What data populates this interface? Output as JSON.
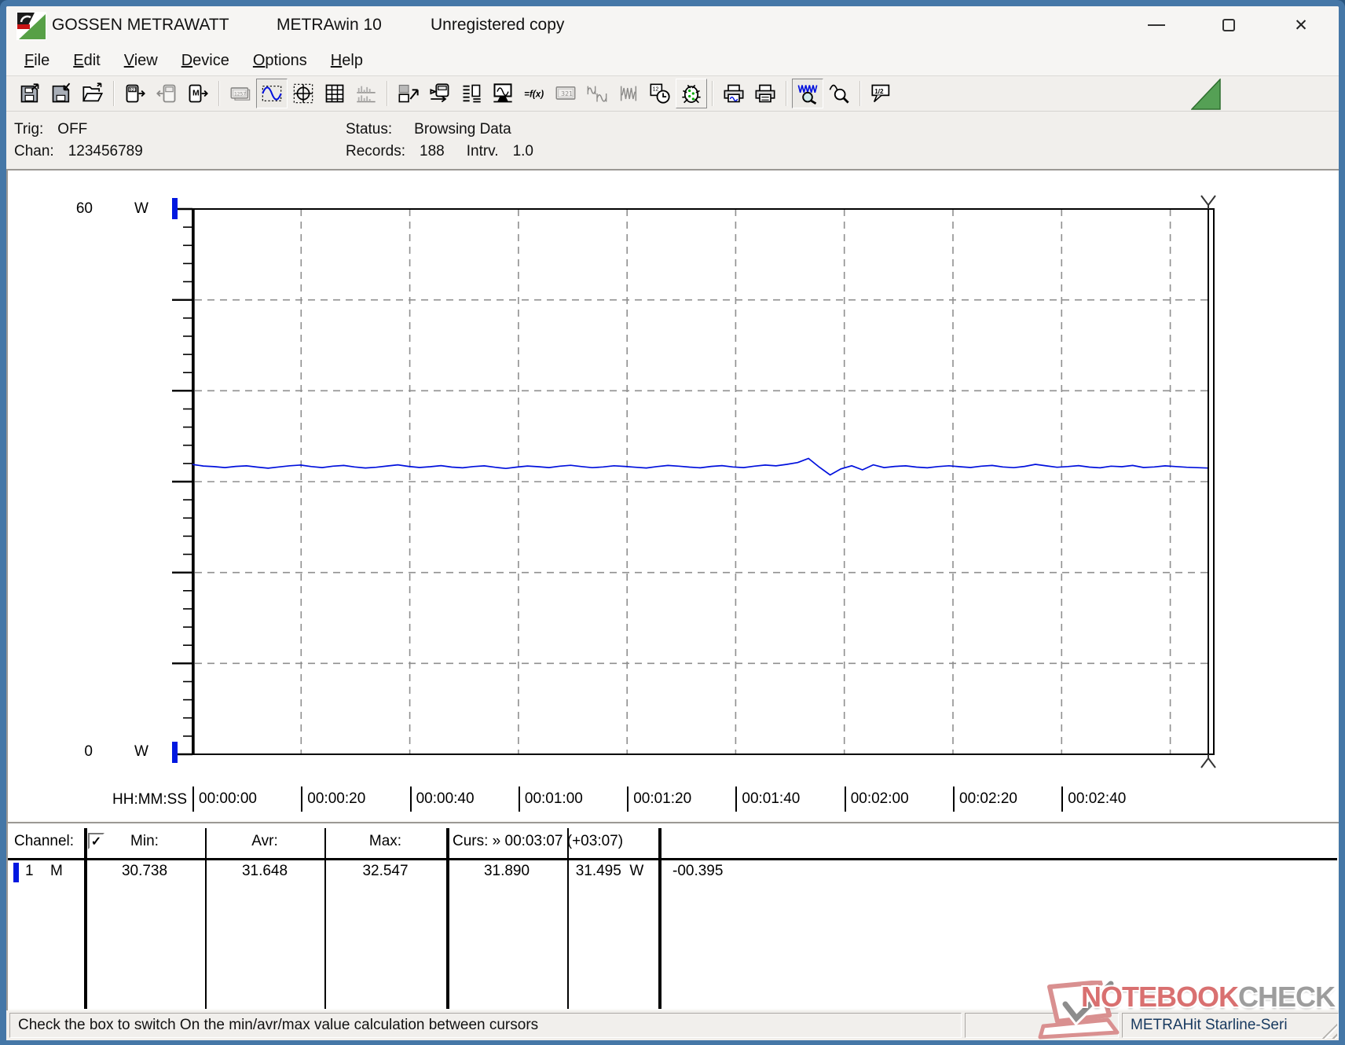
{
  "titlebar": {
    "brand": "GOSSEN METRAWATT",
    "app": "METRAwin 10",
    "license": "Unregistered copy",
    "close_glyph": "✕",
    "icons": [
      "brand-logo",
      "minimize-icon",
      "maximize-icon",
      "close-icon"
    ]
  },
  "menu": {
    "items": [
      {
        "label": "File",
        "accel": 0
      },
      {
        "label": "Edit",
        "accel": 0
      },
      {
        "label": "View",
        "accel": 0
      },
      {
        "label": "Device",
        "accel": 0
      },
      {
        "label": "Options",
        "accel": 0
      },
      {
        "label": "Help",
        "accel": 0
      }
    ]
  },
  "toolbar": {
    "groups": [
      {
        "buttons": [
          {
            "name": "save-as",
            "state": "normal"
          },
          {
            "name": "save",
            "state": "normal"
          },
          {
            "name": "open",
            "state": "normal"
          }
        ]
      },
      {
        "buttons": [
          {
            "name": "read-device",
            "state": "normal"
          },
          {
            "name": "send-device",
            "state": "disabled"
          },
          {
            "name": "read-memory",
            "state": "normal"
          }
        ]
      },
      {
        "buttons": [
          {
            "name": "numeric-display",
            "state": "disabled"
          },
          {
            "name": "chart-view",
            "state": "pressed"
          },
          {
            "name": "xy-view",
            "state": "normal"
          },
          {
            "name": "table-view",
            "state": "normal"
          },
          {
            "name": "histogram-view",
            "state": "disabled"
          }
        ]
      },
      {
        "buttons": [
          {
            "name": "export-transfer",
            "state": "normal"
          },
          {
            "name": "device-settings",
            "state": "normal"
          },
          {
            "name": "channel-list",
            "state": "normal"
          },
          {
            "name": "monitor-view",
            "state": "normal"
          },
          {
            "name": "formula",
            "state": "normal"
          },
          {
            "name": "display-321",
            "state": "disabled"
          },
          {
            "name": "compare-curves",
            "state": "disabled"
          },
          {
            "name": "envelope",
            "state": "disabled"
          },
          {
            "name": "time-clock",
            "state": "normal"
          },
          {
            "name": "debug-bug",
            "state": "raised"
          }
        ]
      },
      {
        "buttons": [
          {
            "name": "print-preview",
            "state": "normal"
          },
          {
            "name": "print",
            "state": "normal"
          }
        ]
      },
      {
        "buttons": [
          {
            "name": "zoom-in",
            "state": "pressed"
          },
          {
            "name": "zoom-out",
            "state": "normal"
          }
        ]
      },
      {
        "buttons": [
          {
            "name": "annotation",
            "state": "normal"
          }
        ]
      }
    ]
  },
  "info": {
    "trig_label": "Trig:",
    "trig_value": "OFF",
    "chan_label": "Chan:",
    "chan_value": "123456789",
    "status_label": "Status:",
    "status_value": "Browsing Data",
    "records_label": "Records:",
    "records_value": "188",
    "interval_label": "Intrv.",
    "interval_value": "1.0"
  },
  "chart_data": {
    "type": "line",
    "title": "",
    "xlabel": "HH:MM:SS",
    "ylabel": "W",
    "ylim": [
      0,
      60
    ],
    "y_max_label": "60",
    "y_min_label": "0",
    "unit": "W",
    "y_major_step": 10,
    "y_minor_step": 2,
    "x_seconds_span": 187,
    "x_tick_interval_s": 20,
    "x_tick_labels": [
      "00:00:00",
      "00:00:20",
      "00:00:40",
      "00:01:00",
      "00:01:20",
      "00:01:40",
      "00:02:00",
      "00:02:20",
      "00:02:40"
    ],
    "grid": "dashed",
    "legend": "none",
    "cursor": {
      "label": "Curs: » 00:03:07 (+03:07)",
      "time": "00:03:07",
      "value_a": 31.89,
      "value_b": 31.495,
      "delta": -0.395
    },
    "stats": {
      "min": 30.738,
      "avr": 31.648,
      "max": 32.547
    },
    "series": [
      {
        "name": "channel-1-power",
        "color": "#0010dd",
        "values": [
          31.89,
          31.72,
          31.65,
          31.55,
          31.68,
          31.74,
          31.6,
          31.48,
          31.62,
          31.75,
          31.82,
          31.66,
          31.55,
          31.7,
          31.78,
          31.62,
          31.5,
          31.58,
          31.72,
          31.85,
          31.68,
          31.56,
          31.64,
          31.76,
          31.6,
          31.52,
          31.66,
          31.74,
          31.58,
          31.45,
          31.6,
          31.72,
          31.64,
          31.55,
          31.7,
          31.8,
          31.66,
          31.54,
          31.62,
          31.75,
          31.68,
          31.58,
          31.5,
          31.66,
          31.78,
          31.7,
          31.6,
          31.52,
          31.68,
          31.76,
          31.62,
          31.55,
          31.7,
          31.82,
          31.74,
          31.9,
          32.1,
          32.547,
          31.6,
          30.738,
          31.4,
          31.75,
          31.3,
          31.85,
          31.55,
          31.68,
          31.74,
          31.6,
          31.52,
          31.66,
          31.75,
          31.64,
          31.56,
          31.7,
          31.78,
          31.62,
          31.54,
          31.68,
          31.9,
          31.74,
          31.58,
          31.66,
          31.76,
          31.6,
          31.52,
          31.7,
          31.64,
          31.78,
          31.56,
          31.62,
          31.74,
          31.66,
          31.58,
          31.54,
          31.495
        ]
      }
    ]
  },
  "table": {
    "header": {
      "channel": "Channel:",
      "min": "Min:",
      "avr": "Avr:",
      "max": "Max:",
      "cursor": "Curs: » 00:03:07 (+03:07)"
    },
    "checkbox_checked": true,
    "check_glyph": "✓",
    "row": {
      "channel": "1",
      "mode": "M",
      "min": "30.738",
      "avr": "31.648",
      "max": "32.547",
      "cursor_a": "31.890",
      "cursor_b": "31.495",
      "unit": "W",
      "delta": "-00.395"
    }
  },
  "statusbar": {
    "message": "Check the box to switch On the min/avr/max value calculation between cursors",
    "device": "METRAHit Starline-Seri"
  },
  "watermark": {
    "word1": "NOTEBOOK",
    "word2": "CHECK",
    "icon": "laptop-check-icon"
  },
  "colors": {
    "frame": "#4577a7",
    "trace": "#0010dd",
    "marker": "#0018e0",
    "watermark_red": "#d97070",
    "watermark_gray": "#9d9d9d",
    "triangle_green": "#55a055"
  }
}
